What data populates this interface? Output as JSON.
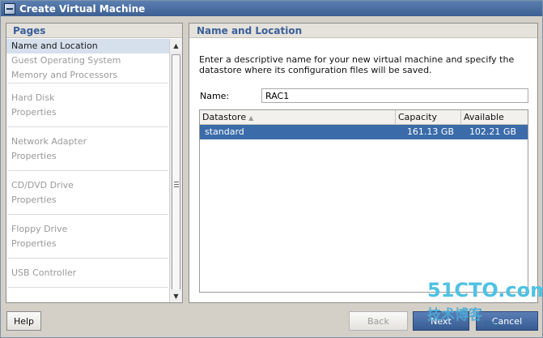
{
  "window": {
    "title": "Create Virtual Machine"
  },
  "pages_panel": {
    "header": "Pages",
    "items": [
      {
        "label": "Name and Location",
        "active": true
      },
      {
        "label": "Guest Operating System"
      },
      {
        "label": "Memory and Processors"
      },
      {
        "label": "Hard Disk"
      },
      {
        "label": "Properties"
      },
      {
        "label": "Network Adapter"
      },
      {
        "label": "Properties"
      },
      {
        "label": "CD/DVD Drive"
      },
      {
        "label": "Properties"
      },
      {
        "label": "Floppy Drive"
      },
      {
        "label": "Properties"
      },
      {
        "label": "USB Controller"
      }
    ]
  },
  "main": {
    "header": "Name and Location",
    "description": "Enter a descriptive name for your new virtual machine and specify the datastore where its configuration files will be saved.",
    "name_label": "Name:",
    "name_value": "RAC1",
    "table": {
      "columns": [
        "Datastore",
        "Capacity",
        "Available"
      ],
      "rows": [
        {
          "datastore": "standard",
          "capacity": "161.13 GB",
          "available": "102.21 GB",
          "selected": true
        }
      ]
    }
  },
  "buttons": {
    "help": "Help",
    "back": "Back",
    "next": "Next",
    "cancel": "Cancel"
  },
  "watermark": {
    "top": "51CTO.com",
    "bottom": "技术博客",
    "sub": "Blog"
  }
}
